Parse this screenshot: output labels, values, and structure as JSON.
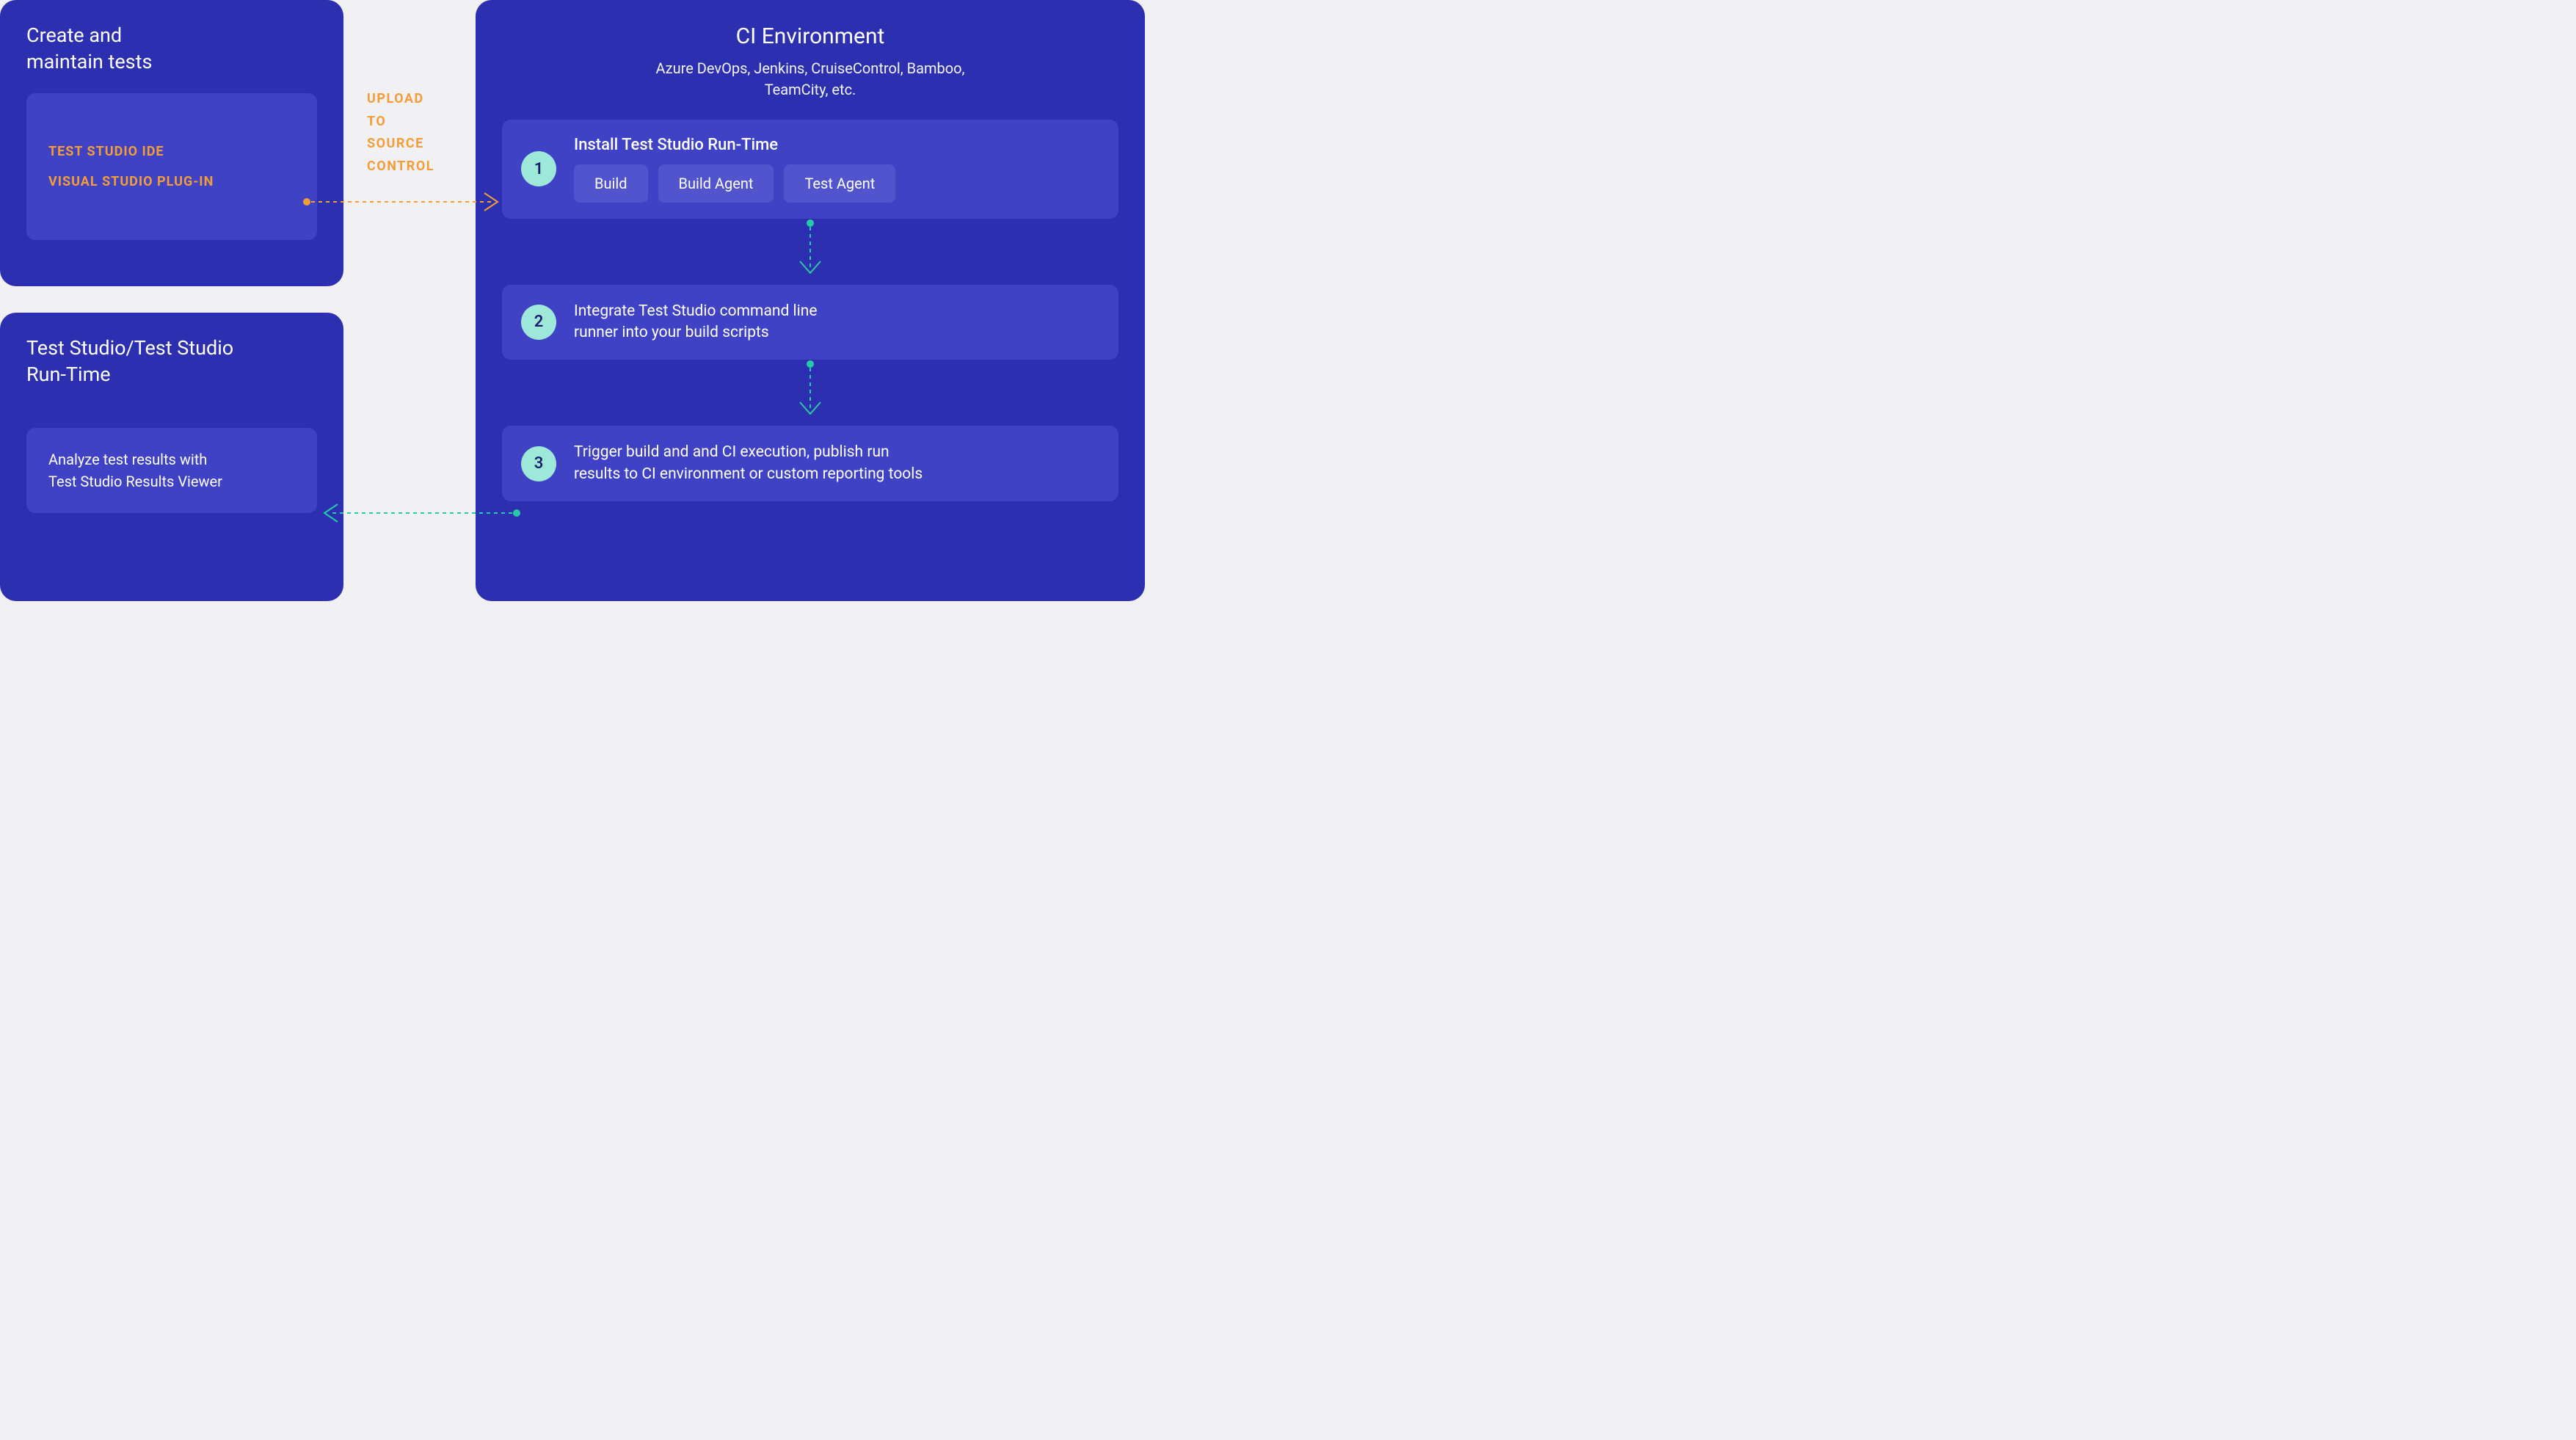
{
  "left_top": {
    "title": "Create and\nmaintain tests",
    "items": [
      "TEST STUDIO IDE",
      "VISUAL STUDIO PLUG-IN"
    ]
  },
  "left_bottom": {
    "title": "Test Studio/Test Studio\nRun-Time",
    "body": "Analyze test results with\nTest Studio Results Viewer"
  },
  "upload_label": "UPLOAD\nTO\nSOURCE\nCONTROL",
  "ci": {
    "title": "CI Environment",
    "subtitle": "Azure DevOps, Jenkins, CruiseControl, Bamboo,\nTeamCity, etc.",
    "step1": {
      "num": "1",
      "title": "Install Test Studio Run-Time",
      "pills": [
        "Build",
        "Build Agent",
        "Test Agent"
      ]
    },
    "step2": {
      "num": "2",
      "text": "Integrate Test Studio command line\nrunner into your build scripts"
    },
    "step3": {
      "num": "3",
      "text": "Trigger build and and CI execution, publish run\nresults to CI environment or custom reporting tools"
    }
  }
}
